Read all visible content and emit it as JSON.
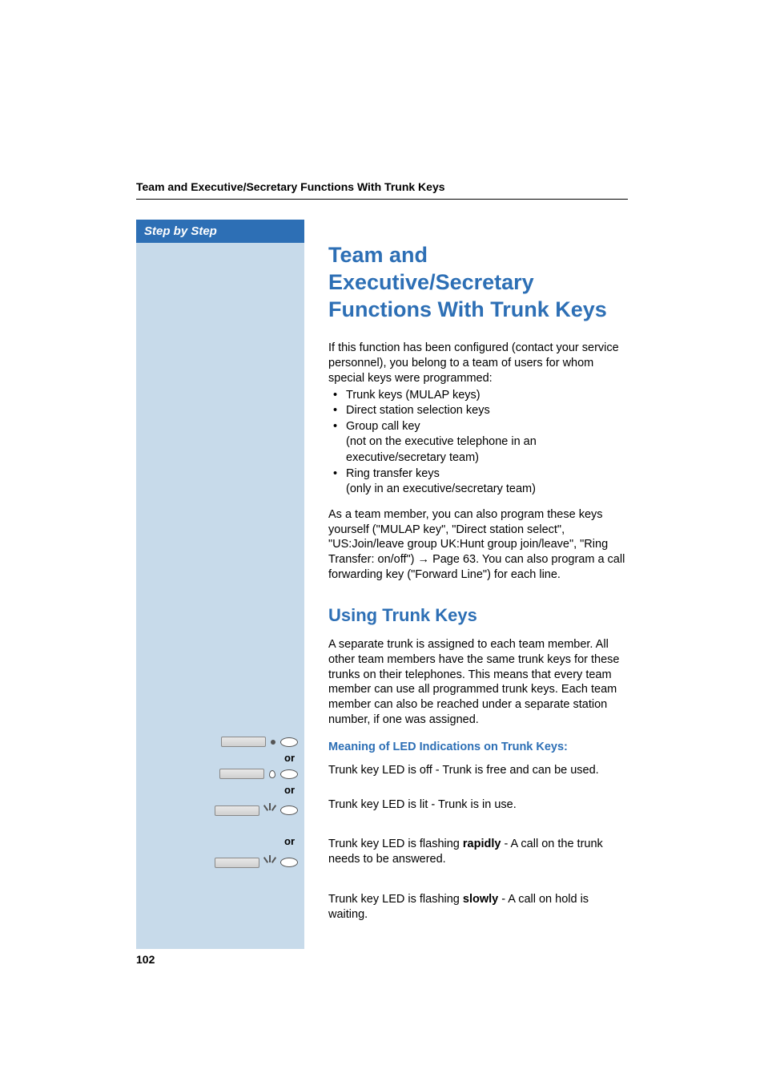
{
  "breadcrumb": "Team and Executive/Secretary Functions With Trunk Keys",
  "sidebar": {
    "step_label": "Step by Step",
    "or_labels": [
      "or",
      "or",
      "or"
    ]
  },
  "main": {
    "title": "Team and Executive/Secretary Functions With Trunk Keys",
    "intro": "If this function has been configured (contact your service personnel), you belong to a team of users for whom special keys were programmed:",
    "bullets": {
      "b1": "Trunk keys (MULAP keys)",
      "b2": "Direct station selection keys",
      "b3_line1": "Group call key",
      "b3_line2": "(not on the executive telephone in an executive/secretary team)",
      "b4_line1": "Ring transfer keys",
      "b4_line2": "(only in an executive/secretary team)"
    },
    "para2_pre": "As a team member, you can also program these keys yourself (\"MULAP key\", \"Direct station select\", \"US:Join/leave group UK:Hunt group join/leave\", \"Ring Transfer: on/off\") ",
    "para2_link": "Page 63",
    "para2_post": ". You can also program a call forwarding key (\"Forward Line\") for each line.",
    "sub_title": "Using Trunk Keys",
    "sub_para": "A separate trunk is assigned to each team member. All other team members have the same trunk keys for these trunks on their telephones. This means that every team member can use all programmed trunk keys. Each team member can also be reached under a separate station number, if one was assigned.",
    "led_heading": "Meaning of LED Indications on Trunk Keys:",
    "led_items": {
      "off": "Trunk key LED is off - Trunk is free and can be used.",
      "lit": "Trunk key LED is lit - Trunk is in use.",
      "rapid_pre": "Trunk key LED is flashing ",
      "rapid_bold": "rapidly",
      "rapid_post": " - A call on the trunk needs to be answered.",
      "slow_pre": "Trunk key LED is flashing ",
      "slow_bold": "slowly",
      "slow_post": " - A call on hold is waiting."
    }
  },
  "page_number": "102"
}
